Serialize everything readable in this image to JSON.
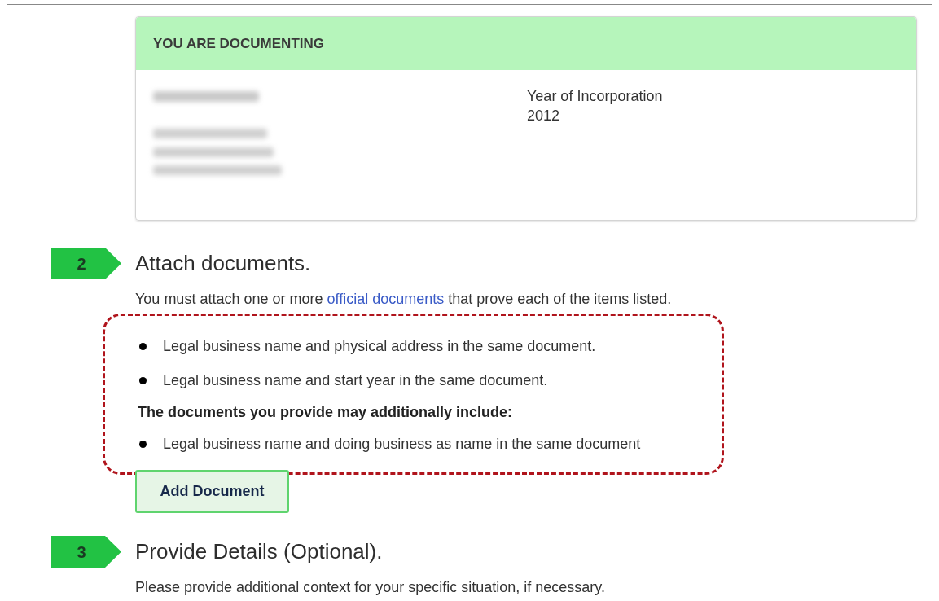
{
  "card": {
    "header": "YOU ARE DOCUMENTING",
    "fields": [
      {
        "label": "Year of Incorporation",
        "value": "2012"
      }
    ]
  },
  "steps": [
    {
      "number": "2",
      "title": "Attach documents.",
      "intro": {
        "before": "You must attach one or more ",
        "link": "official documents",
        "after": " that prove each of the items listed."
      },
      "requirements": [
        {
          "kind": "bullet",
          "text": "Legal business name and physical address in the same document."
        },
        {
          "kind": "bullet",
          "text": "Legal business name and start year in the same document."
        },
        {
          "kind": "subheading",
          "text": "The documents you provide may additionally include:"
        },
        {
          "kind": "bullet",
          "text": "Legal business name and doing business as name in the same document"
        }
      ],
      "button": "Add Document"
    },
    {
      "number": "3",
      "title": "Provide Details (Optional).",
      "intro": {
        "before": "Please provide additional context for your specific situation, if necessary."
      }
    }
  ]
}
